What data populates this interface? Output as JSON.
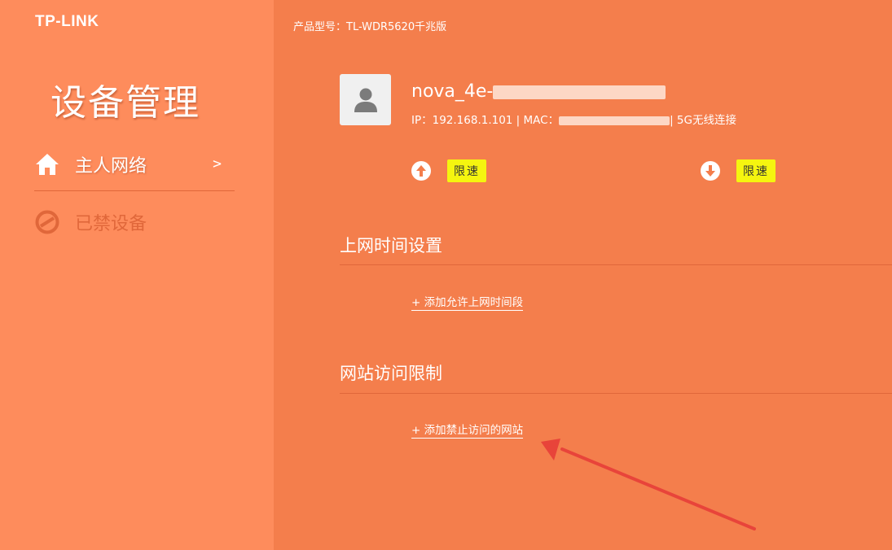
{
  "brand": {
    "logo": "TP-LINK"
  },
  "sidebar": {
    "title": "设备管理",
    "items": [
      {
        "label": "主人网络",
        "icon": "home-icon",
        "chevron": ">",
        "active": true
      },
      {
        "label": "已禁设备",
        "icon": "prohibited-icon",
        "active": false
      }
    ]
  },
  "header": {
    "model_text": "产品型号：TL-WDR5620千兆版"
  },
  "device": {
    "name": "nova_4e-",
    "ip_prefix": "IP：",
    "ip": "192.168.1.101",
    "mac_prefix": " | MAC：",
    "connection": "| 5G无线连接",
    "avatar_icon": "user-avatar-icon"
  },
  "speed": {
    "upload_icon": "upload-arrow-icon",
    "download_icon": "download-arrow-icon",
    "upload_limit_label": "限速",
    "download_limit_label": "限速"
  },
  "sections": {
    "time": {
      "title": "上网时间设置",
      "add_label": "+ 添加允许上网时间段"
    },
    "site": {
      "title": "网站访问限制",
      "add_label": "+ 添加禁止访问的网站"
    }
  },
  "colors": {
    "sidebar_bg": "#fe8c5c",
    "main_bg": "#f47e4c",
    "limit_badge": "#f5f50f",
    "annotation_arrow": "#e8443a"
  }
}
